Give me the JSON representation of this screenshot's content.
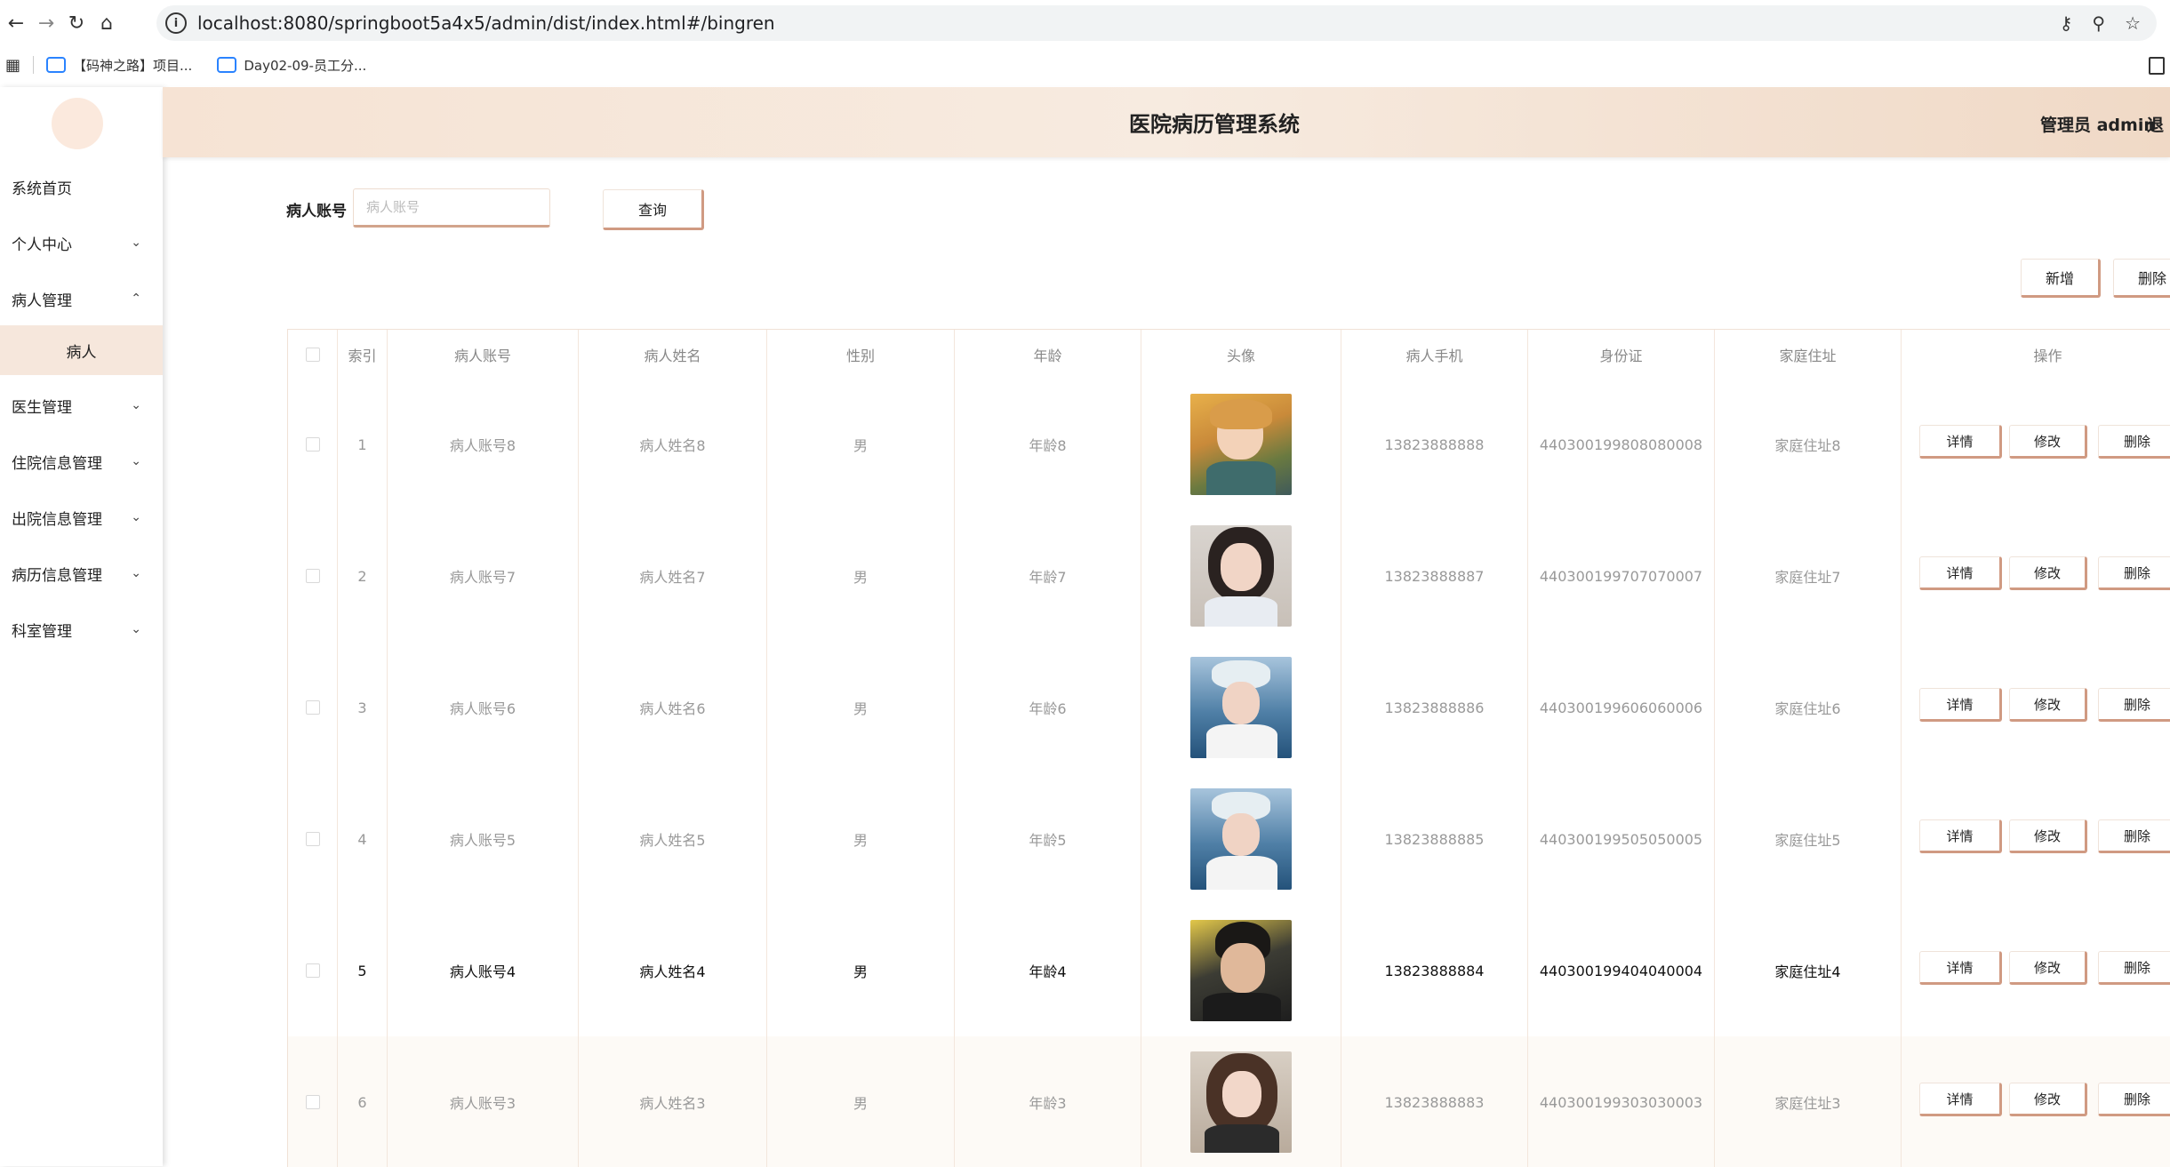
{
  "browser": {
    "url": "localhost:8080/springboot5a4x5/admin/dist/index.html#/bingren",
    "bookmarks": [
      "【码神之路】项目...",
      "Day02-09-员工分..."
    ]
  },
  "header": {
    "title": "医院病历管理系统",
    "user": "管理员 admin",
    "logout": "退"
  },
  "sidebar": {
    "items": [
      {
        "label": "系统首页"
      },
      {
        "label": "个人中心"
      },
      {
        "label": "病人管理"
      },
      {
        "label": "医生管理"
      },
      {
        "label": "住院信息管理"
      },
      {
        "label": "出院信息管理"
      },
      {
        "label": "病历信息管理"
      },
      {
        "label": "科室管理"
      }
    ],
    "sub_item": "病人"
  },
  "search": {
    "label": "病人账号",
    "placeholder": "病人账号",
    "query_button": "查询"
  },
  "toolbar": {
    "add": "新增",
    "delete": "删除"
  },
  "table": {
    "columns": [
      "索引",
      "病人账号",
      "病人姓名",
      "性别",
      "年龄",
      "头像",
      "病人手机",
      "身份证",
      "家庭住址",
      "操作"
    ],
    "actions": [
      "详情",
      "修改",
      "删除"
    ],
    "rows": [
      {
        "index": "1",
        "account": "病人账号8",
        "name": "病人姓名8",
        "gender": "男",
        "age": "年龄8",
        "phone": "13823888888",
        "id_card": "440300199808080008",
        "address": "家庭住址8"
      },
      {
        "index": "2",
        "account": "病人账号7",
        "name": "病人姓名7",
        "gender": "男",
        "age": "年龄7",
        "phone": "13823888887",
        "id_card": "440300199707070007",
        "address": "家庭住址7"
      },
      {
        "index": "3",
        "account": "病人账号6",
        "name": "病人姓名6",
        "gender": "男",
        "age": "年龄6",
        "phone": "13823888886",
        "id_card": "440300199606060006",
        "address": "家庭住址6"
      },
      {
        "index": "4",
        "account": "病人账号5",
        "name": "病人姓名5",
        "gender": "男",
        "age": "年龄5",
        "phone": "13823888885",
        "id_card": "440300199505050005",
        "address": "家庭住址5"
      },
      {
        "index": "5",
        "account": "病人账号4",
        "name": "病人姓名4",
        "gender": "男",
        "age": "年龄4",
        "phone": "13823888884",
        "id_card": "440300199404040004",
        "address": "家庭住址4"
      },
      {
        "index": "6",
        "account": "病人账号3",
        "name": "病人姓名3",
        "gender": "男",
        "age": "年龄3",
        "phone": "13823888883",
        "id_card": "440300199303030003",
        "address": "家庭住址3"
      }
    ]
  }
}
